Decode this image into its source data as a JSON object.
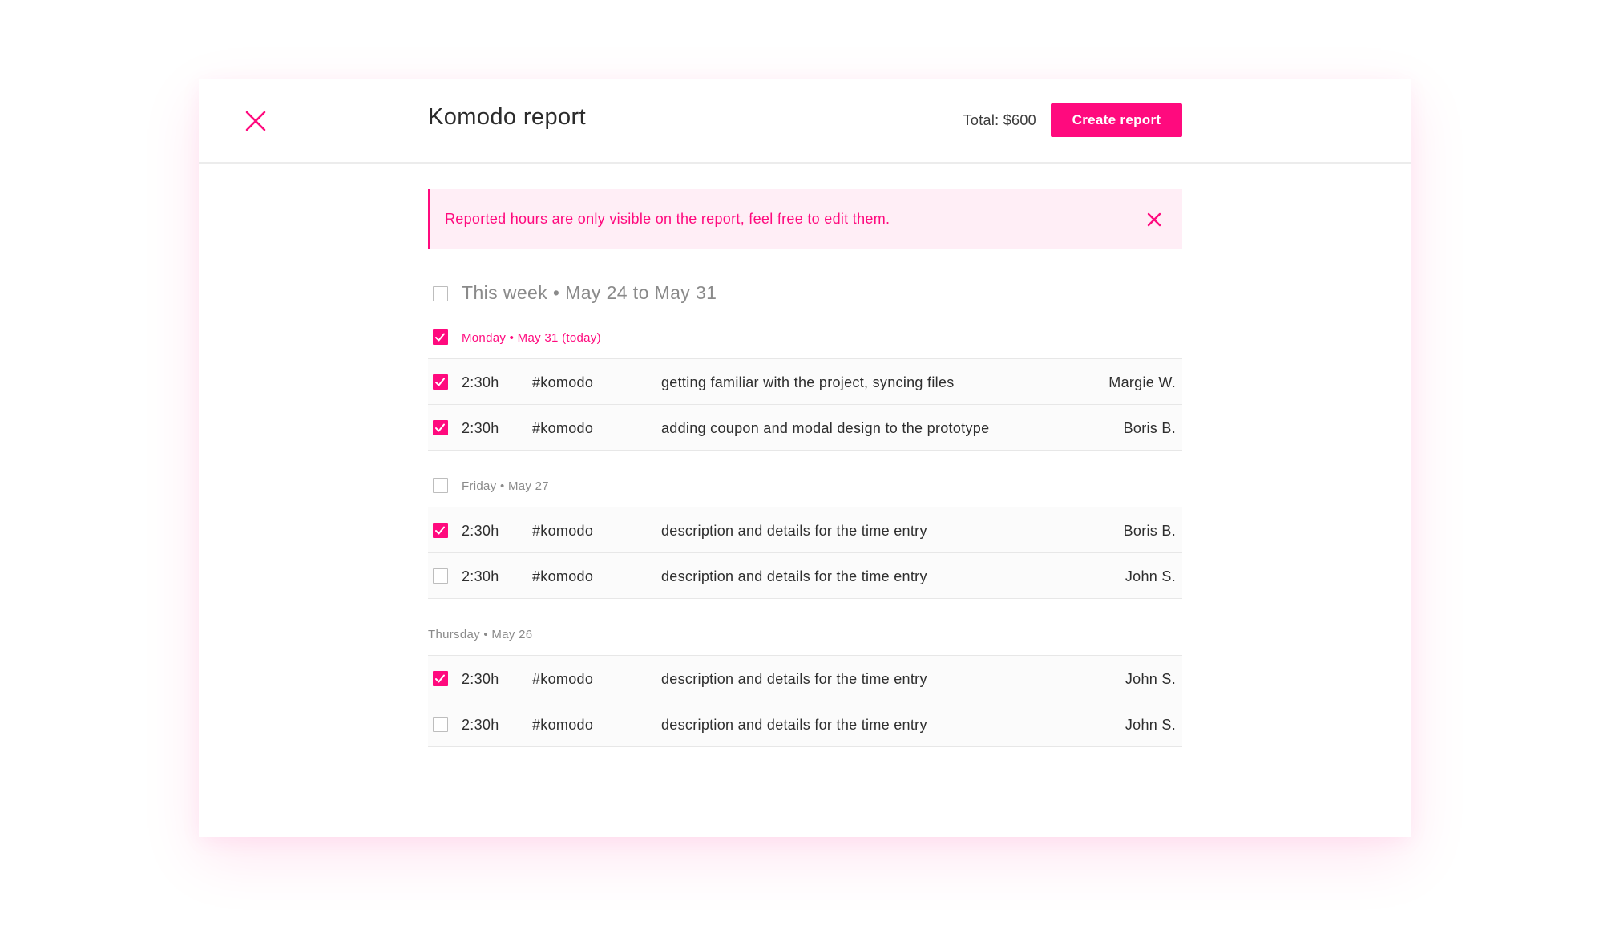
{
  "header": {
    "title": "Komodo report",
    "total": "Total: $600",
    "create_label": "Create report"
  },
  "notice": {
    "text": "Reported hours are only visible on the report, feel free to edit them."
  },
  "week": {
    "label": "This week • May 24 to May 31",
    "checked": false
  },
  "groups": [
    {
      "label": "Monday • May 31 (today)",
      "checked": true,
      "rows": [
        {
          "hours": "2:30h",
          "tag": "#komodo",
          "desc": "getting familiar with the project, syncing files",
          "user": "Margie W.",
          "checked": true
        },
        {
          "hours": "2:30h",
          "tag": "#komodo",
          "desc": "adding coupon and modal design to the prototype",
          "user": "Boris B.",
          "checked": true
        }
      ]
    },
    {
      "label": "Friday • May 27",
      "checked": false,
      "rows": [
        {
          "hours": "2:30h",
          "tag": "#komodo",
          "desc": "description and details for the time entry",
          "user": "Boris B.",
          "checked": true
        },
        {
          "hours": "2:30h",
          "tag": "#komodo",
          "desc": "description and details for the time entry",
          "user": "John S.",
          "checked": false
        }
      ]
    },
    {
      "label": "Thursday • May 26",
      "rows": [
        {
          "hours": "2:30h",
          "tag": "#komodo",
          "desc": "description and details for the time entry",
          "user": "John S.",
          "checked": true
        },
        {
          "hours": "2:30h",
          "tag": "#komodo",
          "desc": "description and details for the time entry",
          "user": "John S.",
          "checked": false
        }
      ]
    }
  ],
  "colors": {
    "accent": "#ff0a7e",
    "notice_bg": "#ffeef6",
    "muted_text": "#8a8a8a"
  },
  "icons": {
    "close": "close-icon",
    "check": "check-icon"
  }
}
